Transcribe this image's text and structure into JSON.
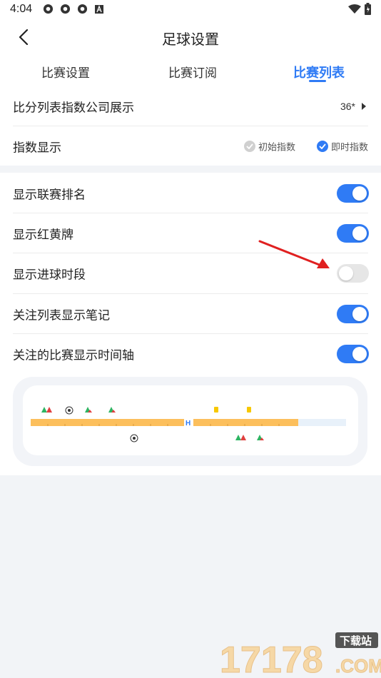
{
  "status": {
    "time": "4:04"
  },
  "header": {
    "title": "足球设置"
  },
  "tabs": [
    {
      "label": "比赛设置"
    },
    {
      "label": "比赛订阅"
    },
    {
      "label": "比赛列表"
    }
  ],
  "score_list": {
    "label": "比分列表指数公司展示",
    "value": "36*"
  },
  "index_display": {
    "label": "指数显示",
    "option_initial": "初始指数",
    "option_live": "即时指数",
    "initial_checked": false,
    "live_checked": true
  },
  "toggles": [
    {
      "label": "显示联赛排名",
      "on": true
    },
    {
      "label": "显示红黄牌",
      "on": true
    },
    {
      "label": "显示进球时段",
      "on": false
    },
    {
      "label": "关注列表显示笔记",
      "on": true
    },
    {
      "label": "关注的比赛显示时间轴",
      "on": true
    }
  ],
  "timeline_preview": {
    "half_label": "H"
  },
  "watermark": {
    "text": "17178",
    "badge": "下载站",
    "domain": ".COM"
  },
  "colors": {
    "accent": "#2f7bf5",
    "timeline_bar": "#fcbf5c",
    "arrow": "#e02020"
  }
}
